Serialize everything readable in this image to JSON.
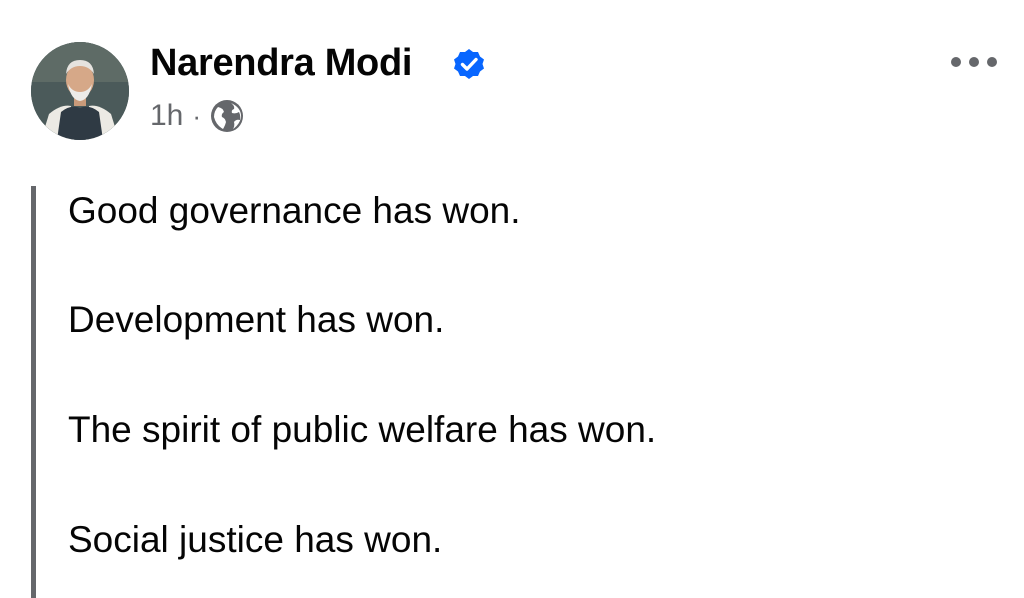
{
  "post": {
    "author": {
      "name": "Narendra Modi",
      "verified_icon": "verified-badge-icon",
      "avatar_icon": "profile-photo"
    },
    "meta": {
      "time": "1h",
      "separator": "·",
      "audience_icon": "globe-icon"
    },
    "more_icon": "more-options-icon",
    "lines": [
      "Good governance has won.",
      "Development has won.",
      "The spirit of public welfare has won.",
      "Social justice has won."
    ]
  },
  "colors": {
    "text_primary": "#050505",
    "text_secondary": "#65676b",
    "verified_blue": "#0866ff",
    "quote_bar": "#65676b",
    "background": "#ffffff"
  }
}
